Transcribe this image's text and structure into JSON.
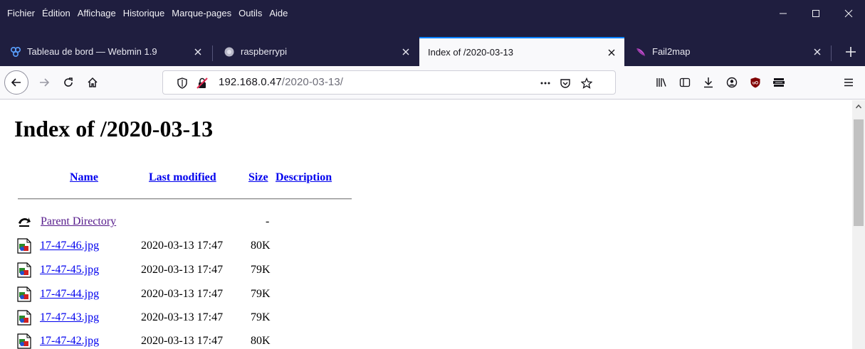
{
  "menu": {
    "items": [
      {
        "label": "Fichier"
      },
      {
        "label": "Édition"
      },
      {
        "label": "Affichage"
      },
      {
        "label": "Historique"
      },
      {
        "label": "Marque-pages"
      },
      {
        "label": "Outils"
      },
      {
        "label": "Aide"
      }
    ]
  },
  "tabs": [
    {
      "title": "Tableau de bord — Webmin 1.9",
      "icon": "webmin-icon",
      "active": false
    },
    {
      "title": "raspberrypi",
      "icon": "raspberry-icon",
      "active": false
    },
    {
      "title": "Index of /2020-03-13",
      "icon": "",
      "active": true
    },
    {
      "title": "Fail2map",
      "icon": "feather-icon",
      "active": false
    }
  ],
  "urlbar": {
    "host": "192.168.0.47",
    "path": "/2020-03-13/"
  },
  "page": {
    "heading": "Index of /2020-03-13",
    "columns": {
      "name": "Name",
      "last_modified": "Last modified",
      "size": "Size",
      "description": "Description"
    },
    "parent": {
      "name": "Parent Directory",
      "size": "-"
    },
    "files": [
      {
        "name": "17-47-46.jpg",
        "modified": "2020-03-13 17:47",
        "size": "80K"
      },
      {
        "name": "17-47-45.jpg",
        "modified": "2020-03-13 17:47",
        "size": "79K"
      },
      {
        "name": "17-47-44.jpg",
        "modified": "2020-03-13 17:47",
        "size": "79K"
      },
      {
        "name": "17-47-43.jpg",
        "modified": "2020-03-13 17:47",
        "size": "79K"
      },
      {
        "name": "17-47-42.jpg",
        "modified": "2020-03-13 17:47",
        "size": "80K"
      }
    ]
  },
  "colors": {
    "chrome_dark": "#1f1e3f",
    "toolbar": "#f9f9fb",
    "active_tab_accent": "#0a84ff",
    "link": "#0000ee",
    "visited_link": "#551a8b"
  }
}
